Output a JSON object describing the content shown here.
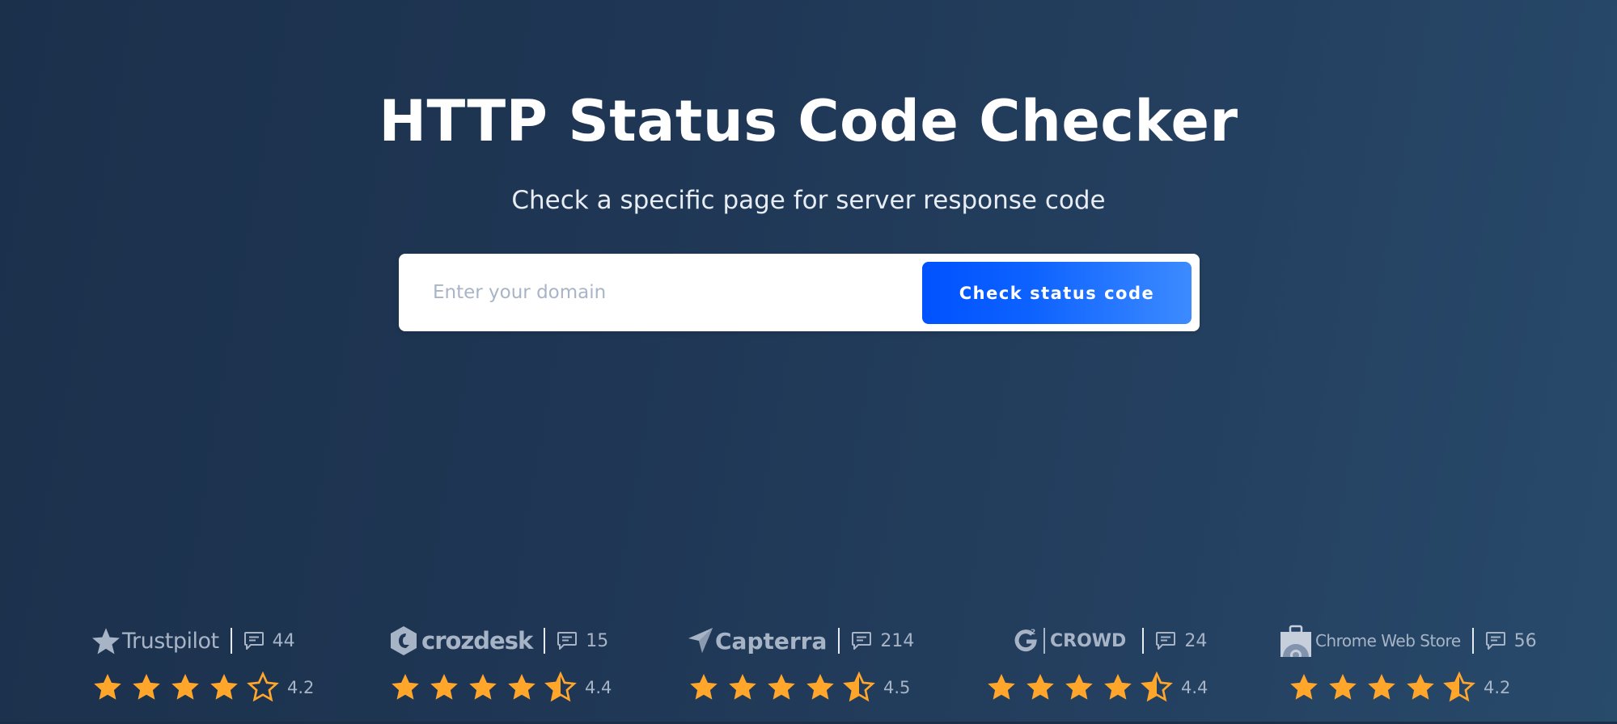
{
  "hero": {
    "title": "HTTP Status Code Checker",
    "subtitle": "Check a specific page for server response code"
  },
  "search": {
    "placeholder": "Enter your domain",
    "value": "",
    "button_label": "Check status code"
  },
  "colors": {
    "star_fill": "#ffa62b",
    "logo_gray": "#a7b4c6",
    "button_start": "#0052ff",
    "button_end": "#3d8bff"
  },
  "reviews": [
    {
      "platform": "Trustpilot",
      "icon": "trustpilot-star-icon",
      "review_count": "44",
      "rating": "4.2",
      "stars": [
        1,
        1,
        1,
        1,
        0
      ]
    },
    {
      "platform": "crozdesk",
      "icon": "crozdesk-logo-icon",
      "review_count": "15",
      "rating": "4.4",
      "stars": [
        1,
        1,
        1,
        1,
        0.5
      ]
    },
    {
      "platform": "Capterra",
      "icon": "capterra-arrow-icon",
      "review_count": "214",
      "rating": "4.5",
      "stars": [
        1,
        1,
        1,
        1,
        0.5
      ]
    },
    {
      "platform": "CROWD",
      "platform_prefix": "G2",
      "icon": "g2-logo-icon",
      "review_count": "24",
      "rating": "4.4",
      "stars": [
        1,
        1,
        1,
        1,
        0.5
      ]
    },
    {
      "platform": "Chrome Web Store",
      "icon": "chrome-web-store-icon",
      "review_count": "56",
      "rating": "4.2",
      "stars": [
        1,
        1,
        1,
        1,
        0.5
      ]
    }
  ]
}
